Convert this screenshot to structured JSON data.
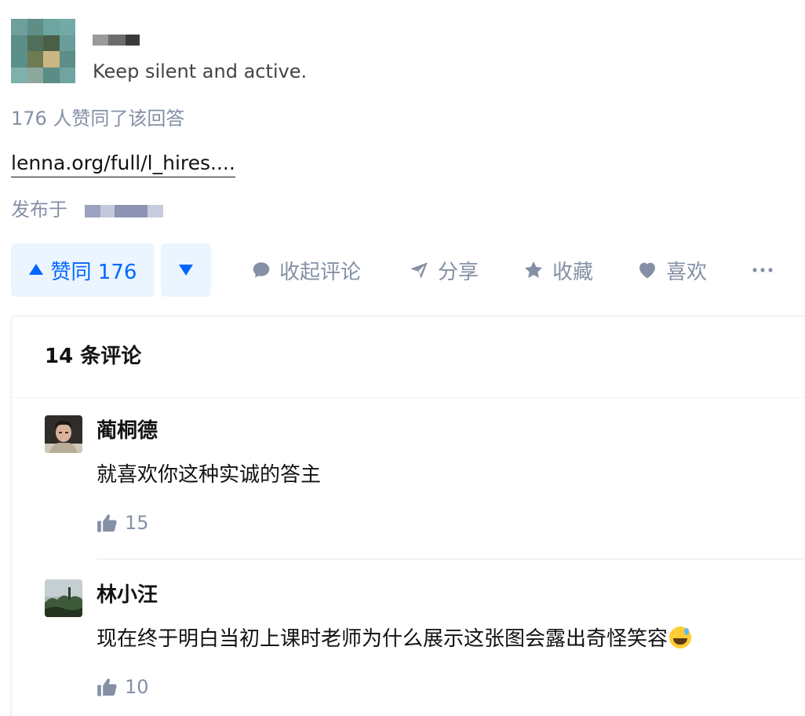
{
  "author": {
    "bio": "Keep silent and active."
  },
  "answer": {
    "vote_summary": "176 人赞同了该回答",
    "link_text": "lenna.org/full/l_hires....",
    "published_label": "发布于"
  },
  "actions": {
    "vote_up_label": "赞同 176",
    "collapse_comments_label": "收起评论",
    "share_label": "分享",
    "favorite_label": "收藏",
    "like_label": "喜欢"
  },
  "comments": {
    "title": "14 条评论",
    "items": [
      {
        "name": "蔺桐德",
        "text": "就喜欢你这种实诚的答主",
        "likes": "15"
      },
      {
        "name": "林小汪",
        "text": "现在终于明白当初上课时老师为什么展示这张图会露出奇怪笑容",
        "likes": "10"
      }
    ]
  },
  "colors": {
    "accent": "#0066ff",
    "accent_bg": "#ebf5ff",
    "muted": "#8590a6"
  }
}
